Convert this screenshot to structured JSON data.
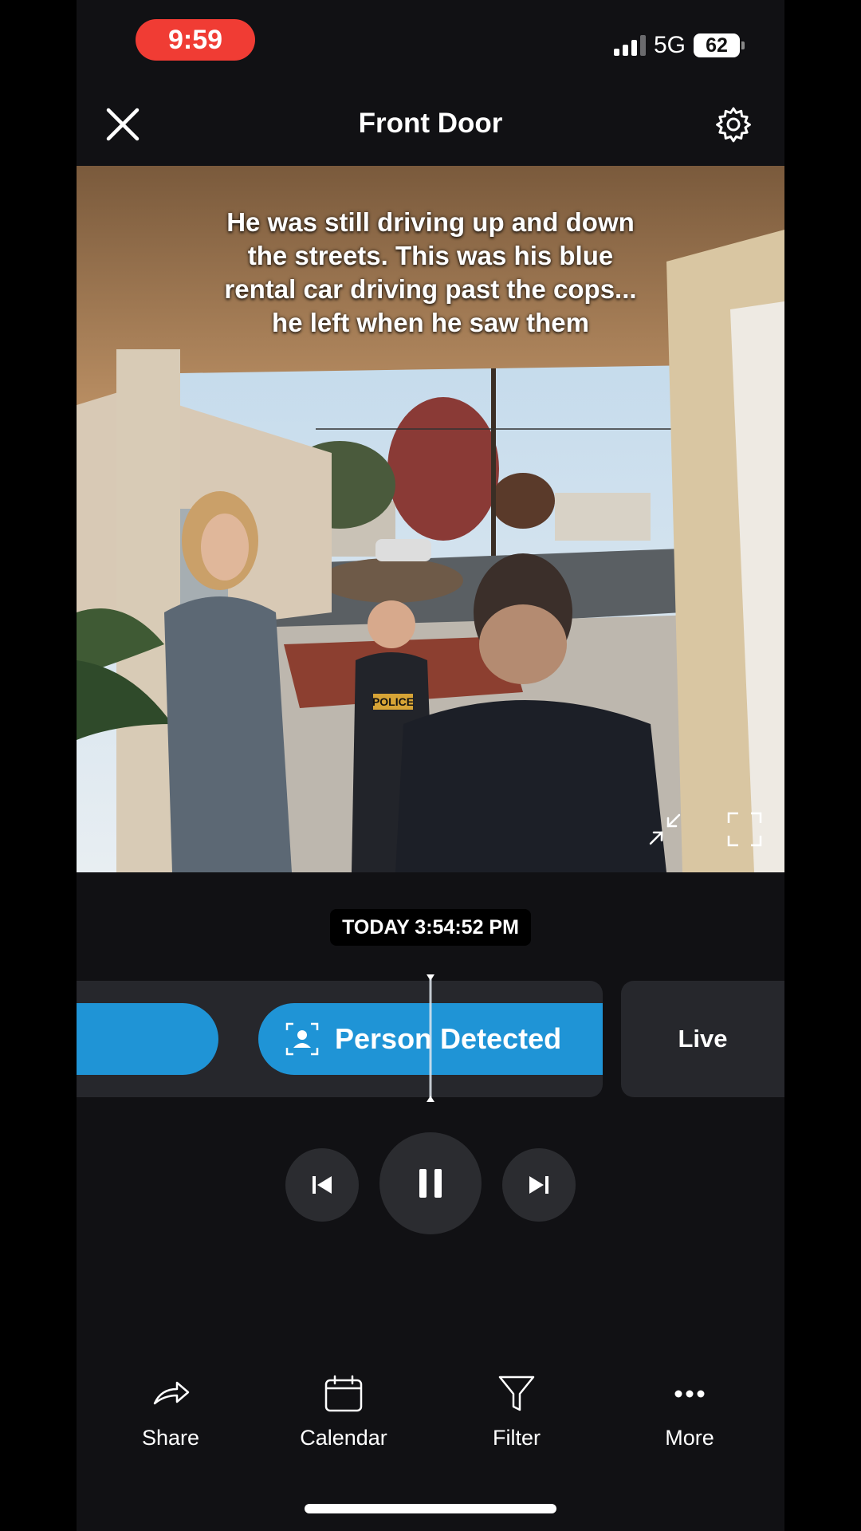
{
  "status_bar": {
    "time": "9:59",
    "network": "5G",
    "battery": "62"
  },
  "header": {
    "title": "Front Door",
    "close_icon": "close-icon",
    "settings_icon": "gear-icon"
  },
  "video": {
    "caption_lines": [
      "He was still driving up and down",
      "the streets. This was his blue",
      "rental car driving past the cops...",
      "he left when he saw them"
    ],
    "officer_badge_text": "POLICE",
    "minimize_icon": "minimize-arrows-icon",
    "fullscreen_icon": "fullscreen-corners-icon"
  },
  "timestamp": "TODAY 3:54:52 PM",
  "timeline": {
    "current_event_label": "Person Detected",
    "live_label": "Live",
    "accent_color": "#1f94d6"
  },
  "playback": {
    "previous_icon": "skip-previous-icon",
    "pause_icon": "pause-icon",
    "next_icon": "skip-next-icon"
  },
  "bottom_bar": {
    "share": "Share",
    "calendar": "Calendar",
    "filter": "Filter",
    "more": "More"
  }
}
